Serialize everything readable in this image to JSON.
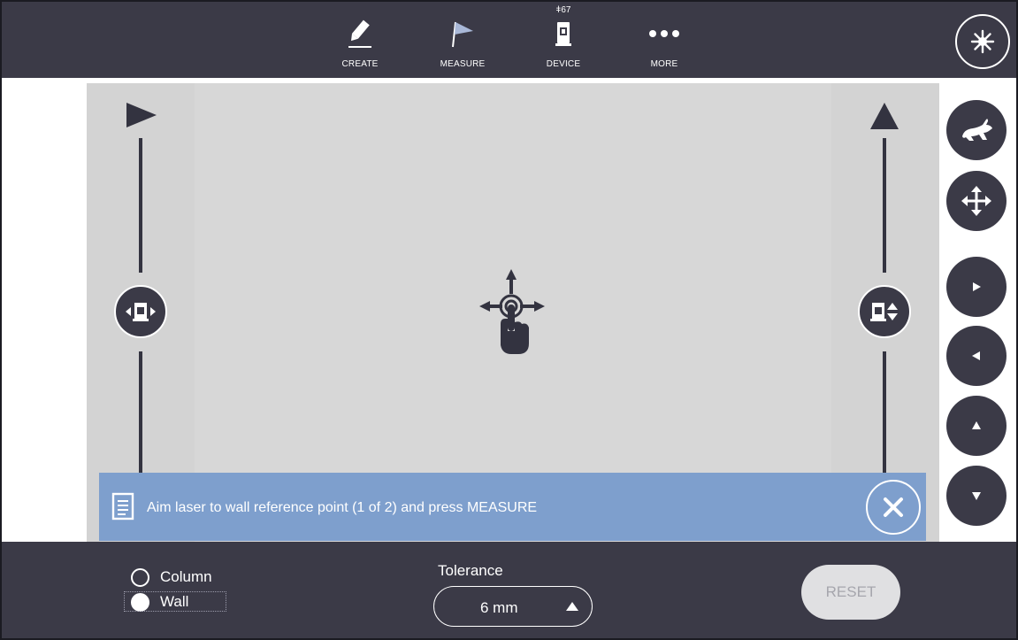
{
  "toolbar": {
    "items": [
      {
        "label": "CREATE",
        "icon": "pencil-icon"
      },
      {
        "label": "MEASURE",
        "icon": "flag-icon"
      },
      {
        "label": "DEVICE",
        "icon": "total-station-icon",
        "count": "67"
      },
      {
        "label": "MORE",
        "icon": "more-dots-icon"
      }
    ],
    "laser_icon": "laser-icon"
  },
  "pad": {
    "left_arrow_icon": "play-right-icon",
    "right_arrow_icon": "play-up-icon",
    "left_handle_icon": "rotate-horizontal-icon",
    "right_handle_icon": "rotate-vertical-icon",
    "center_icon": "move-touch-icon"
  },
  "banner": {
    "message": "Aim laser to wall reference point (1 of 2) and press MEASURE",
    "doc_icon": "document-icon",
    "close_icon": "close-icon"
  },
  "side_controls": [
    "rabbit-speed-icon",
    "move-arrows-icon",
    "arrow-right-icon",
    "arrow-left-icon",
    "arrow-up-icon",
    "arrow-down-icon"
  ],
  "bottom": {
    "options": [
      {
        "label": "Column",
        "selected": false
      },
      {
        "label": "Wall",
        "selected": true
      }
    ],
    "tolerance_label": "Tolerance",
    "tolerance_value": "6 mm",
    "reset_label": "RESET"
  },
  "colors": {
    "bar": "#3b3a47",
    "pad": "#d7d7d7",
    "banner": "#7e9fcd",
    "reset_bg": "#e0e0e2"
  }
}
